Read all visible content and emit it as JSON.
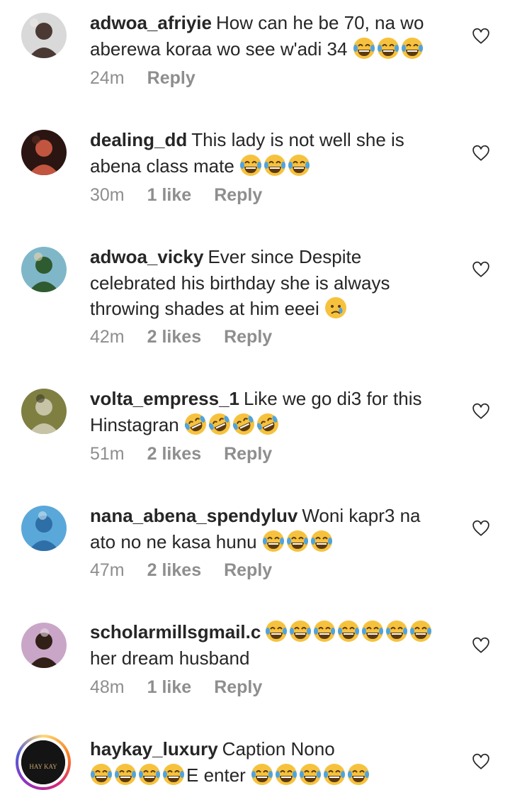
{
  "comments": [
    {
      "username": "adwoa_afriyie",
      "text": "How can he be 70, na wo aberewa koraa wo see w'adi 34",
      "emoji": "😂",
      "emoji_count": 3,
      "time": "24m",
      "likes": "",
      "reply": "Reply",
      "avatar_colors": [
        "#d9d9d9",
        "#4a3a33",
        "#efe7e2"
      ]
    },
    {
      "username": "dealing_dd",
      "text": "This lady is not well she is abena class mate",
      "emoji": "😂",
      "emoji_count": 3,
      "time": "30m",
      "likes": "1 like",
      "reply": "Reply",
      "avatar_colors": [
        "#2a1512",
        "#c2553f",
        "#5a2d22"
      ]
    },
    {
      "username": "adwoa_vicky",
      "text": "Ever since Despite celebrated his birthday she is always throwing shades at him eeei",
      "emoji": "😥",
      "emoji_count": 1,
      "time": "42m",
      "likes": "2 likes",
      "reply": "Reply",
      "avatar_colors": [
        "#7fb7c9",
        "#2f5b31",
        "#e7d6b0"
      ]
    },
    {
      "username": "volta_empress_1",
      "text": "Like we go di3 for this Hinstagran",
      "emoji": "🤣",
      "emoji_count": 4,
      "time": "51m",
      "likes": "2 likes",
      "reply": "Reply",
      "avatar_colors": [
        "#7f7f42",
        "#c7c3a6",
        "#3b3b24"
      ]
    },
    {
      "username": "nana_abena_spendyluv",
      "text": "Woni kapr3 na ato no ne kasa hunu",
      "emoji": "😂",
      "emoji_count": 3,
      "time": "47m",
      "likes": "2 likes",
      "reply": "Reply",
      "avatar_colors": [
        "#5aa8da",
        "#2f6fa7",
        "#cfe6f4"
      ]
    },
    {
      "username": "scholarmillsgmail.c",
      "text": "her dream husband",
      "emoji": "😂",
      "emoji_count": 7,
      "emoji_before_text": true,
      "time": "48m",
      "likes": "1 like",
      "reply": "Reply",
      "avatar_colors": [
        "#c9a6c8",
        "#302017",
        "#e9dbe6"
      ]
    },
    {
      "username": "haykay_luxury",
      "text": "Caption Nono",
      "text2": "E enter",
      "emoji": "😂",
      "emoji_count": 4,
      "emoji2_count": 5,
      "time": "",
      "likes": "",
      "reply": "",
      "avatar_colors": [
        "#141414",
        "#c6a46a",
        "#2b2b2b"
      ],
      "avatar_text": "HAY KAY",
      "story_ring": true
    }
  ]
}
